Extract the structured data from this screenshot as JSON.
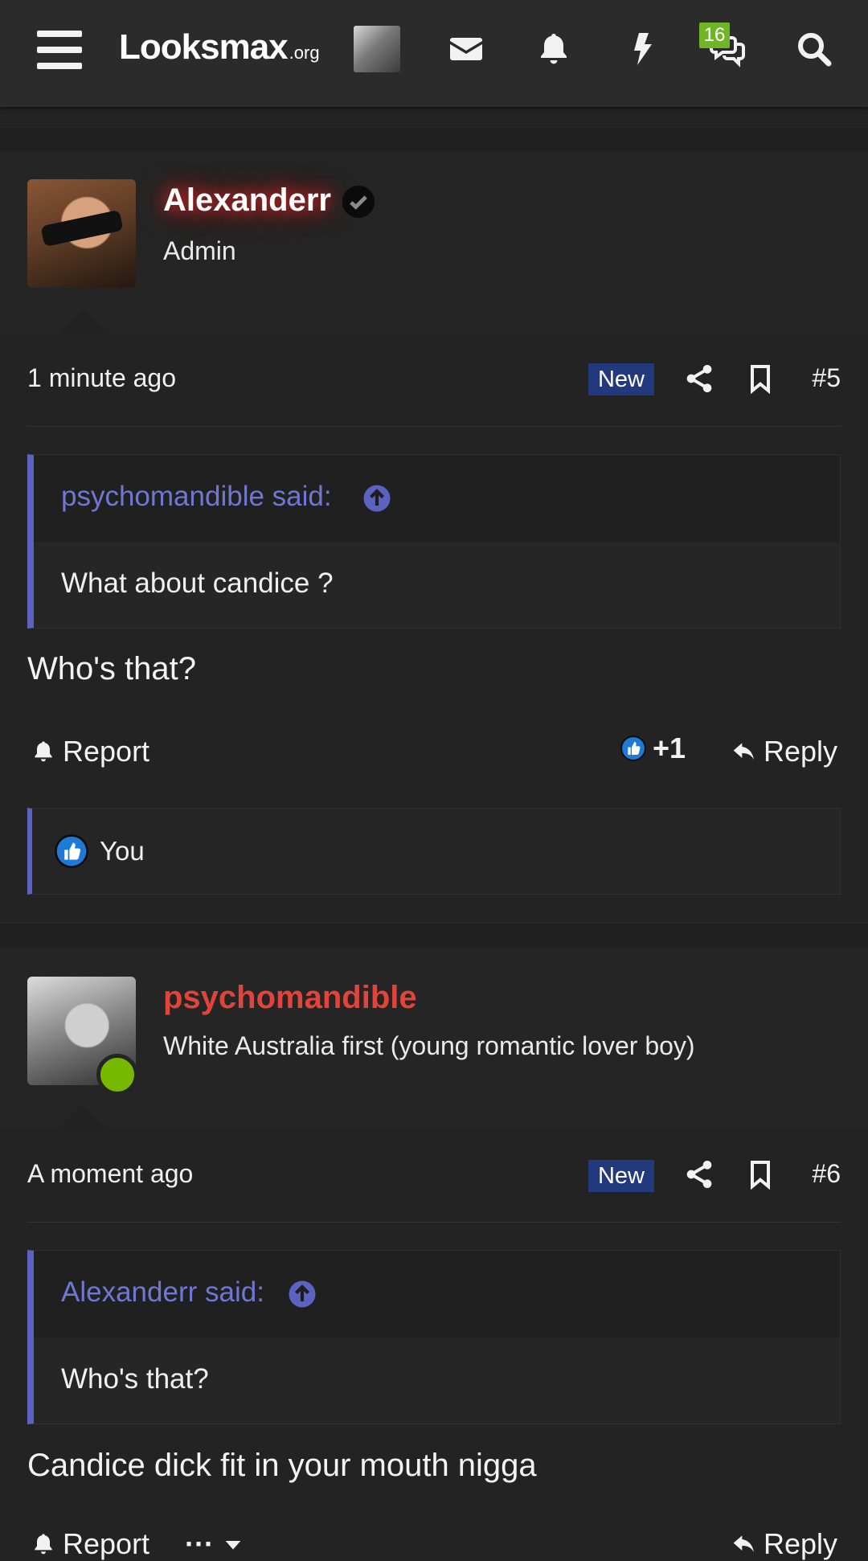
{
  "header": {
    "logo_main": "Looksmax",
    "logo_tld": ".org",
    "conversations_badge": "16"
  },
  "posts": [
    {
      "username": "Alexanderr",
      "user_title": "Admin",
      "verified": true,
      "time": "1 minute ago",
      "new_label": "New",
      "number": "#5",
      "quote_author": "psychomandible said:",
      "quote_text": "What about candice ?",
      "text": "Who's that?",
      "report_label": "Report",
      "like_count": "+1",
      "reply_label": "Reply",
      "reactions_text": "You"
    },
    {
      "username": "psychomandible",
      "user_title": "White Australia first (young romantic lover boy)",
      "online": true,
      "time": "A moment ago",
      "new_label": "New",
      "number": "#6",
      "quote_author": "Alexanderr said:",
      "quote_text": "Who's that?",
      "text": "Candice dick fit in your mouth nigga",
      "report_label": "Report",
      "more_label": "···",
      "reply_label": "Reply"
    }
  ],
  "colors": {
    "background": "#232323",
    "quote_accent": "#5b62c0",
    "quote_author": "#6f78d0",
    "new_badge": "#23397d",
    "username_red": "#e0443a",
    "online": "#76b900",
    "badge_green": "#6fb526"
  },
  "icons": [
    "menu-icon",
    "envelope-icon",
    "bell-icon",
    "bolt-icon",
    "chat-icon",
    "search-icon",
    "share-icon",
    "bookmark-icon",
    "arrow-up-circle-icon",
    "report-bell-icon",
    "like-icon",
    "reply-icon",
    "verified-icon"
  ]
}
